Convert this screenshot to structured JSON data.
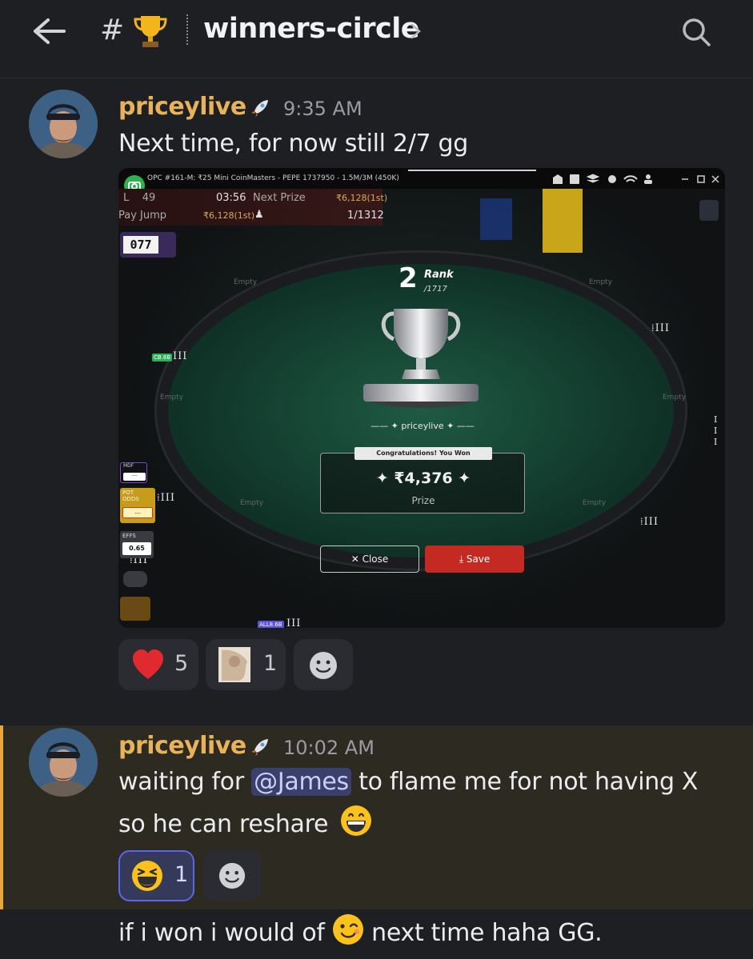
{
  "header": {
    "channel_prefix": "#",
    "channel_name": "winners-circle",
    "icons": [
      "back-arrow-icon",
      "trophy-icon",
      "chevron-right-icon",
      "search-icon"
    ]
  },
  "messages": [
    {
      "author": "priceylive",
      "time": "9:35 AM",
      "text": "Next time, for now still 2/7 gg",
      "attachment": {
        "title": "OPC #161-M: ₹25 Mini CoinMasters - PEPE 1737950 - 1.5M/3M (450K)",
        "level_label": "L",
        "level_value": "49",
        "clock": "03:56",
        "next_prize_label": "Next Prize",
        "next_prize_value": "₹6,128(1st)",
        "pay_jump_label": "Pay Jump",
        "pay_jump_value": "₹6,128(1st)",
        "players": "1/1312",
        "counter": "077",
        "rank_number": "2",
        "rank_label": "Rank",
        "rank_total": "/1717",
        "player_name": "priceylive",
        "congrats": "Congratulations! You Won",
        "amount": "₹4,376",
        "prize_label": "Prize",
        "close_label": "Close",
        "save_label": "Save",
        "seat_empty": "Empty",
        "cb_badge": "CB.6B",
        "all_badge": "ALL8.6B",
        "mdf_label": "MDF",
        "mdf_value": "---",
        "pot_odds_label": "POT ODDS",
        "pot_odds_value": "---",
        "effs_label": "EFFS",
        "effs_value": "0.65"
      },
      "reactions": [
        {
          "emoji": "heart",
          "count": "5"
        },
        {
          "emoji": "custom-image",
          "count": "1"
        }
      ]
    },
    {
      "author": "priceylive",
      "time": "10:02 AM",
      "text_before": "waiting for ",
      "mention": "@James",
      "text_after": " to flame me for not having X",
      "line2": "so he can reshare",
      "reactions": [
        {
          "emoji": "laughing-face",
          "count": "1"
        }
      ]
    },
    {
      "text_before": "if i won i would of",
      "text_after": " next time haha GG."
    }
  ],
  "colors": {
    "background": "#1e1f23",
    "author": "#e8b25a",
    "highlight_bar": "#e7a93a",
    "save_button": "#c42a22"
  }
}
